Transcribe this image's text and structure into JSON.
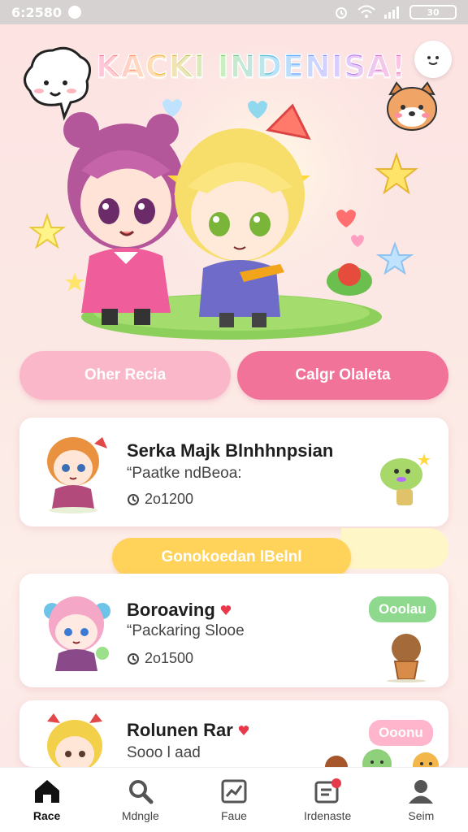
{
  "status_bar": {
    "time": "6:2580",
    "battery": "30"
  },
  "header": {
    "title": "KACKI INDENISA!"
  },
  "actions": {
    "primary_left": "Oher Recia",
    "primary_right": "Calgr Olaleta"
  },
  "cards": [
    {
      "title": "Serka Majk Blnhhnpsian",
      "subtitle": "“Paatke ndBeoa:",
      "meta": "2ο1200"
    },
    {
      "title": "Boroaving",
      "subtitle": "“Packaring Slooe",
      "meta": "2ο1500",
      "tag": "Ooolau"
    },
    {
      "title": "Rolunen Rar",
      "subtitle": "Sooo l aad",
      "tag": "Ooonu"
    }
  ],
  "section": {
    "banner": "Gonokoedan lBelnl"
  },
  "nav": [
    {
      "label": "Race",
      "icon": "home-icon"
    },
    {
      "label": "Mdngle",
      "icon": "search-icon"
    },
    {
      "label": "Faue",
      "icon": "chart-icon"
    },
    {
      "label": "Irdenaste",
      "icon": "notification-icon"
    },
    {
      "label": "Seim",
      "icon": "profile-icon"
    }
  ],
  "colors": {
    "accent": "#f2739a",
    "accent_light": "#fbb7ca",
    "banner": "#ffd25a",
    "tag_green": "#8fd98f"
  }
}
